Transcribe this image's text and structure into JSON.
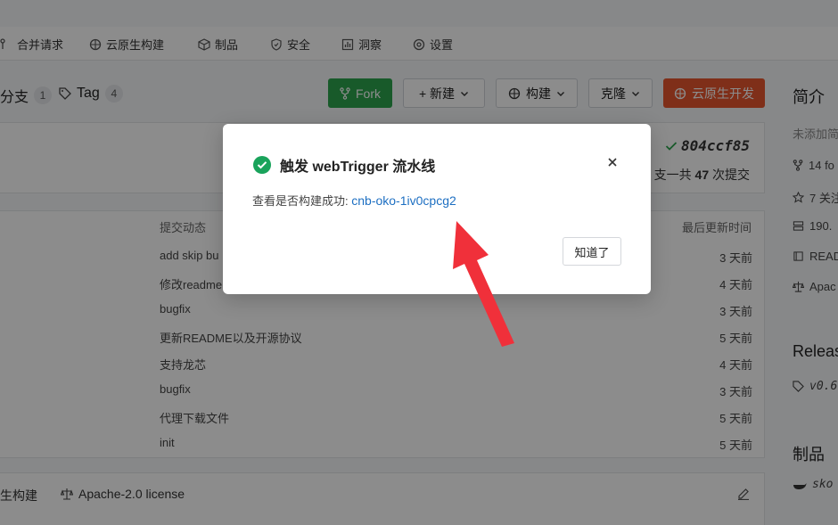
{
  "nav": {
    "items": [
      {
        "label": "合并请求",
        "icon": "merge-request-icon"
      },
      {
        "label": "云原生构建",
        "icon": "cloud-build-icon"
      },
      {
        "label": "制品",
        "icon": "package-icon"
      },
      {
        "label": "安全",
        "icon": "shield-icon"
      },
      {
        "label": "洞察",
        "icon": "chart-icon"
      },
      {
        "label": "设置",
        "icon": "gear-icon"
      }
    ]
  },
  "repo_header": {
    "branch_label": "分支",
    "branch_count": "1",
    "tag_label": "Tag",
    "tag_count": "4",
    "fork_label": "Fork",
    "new_label": "+ 新建",
    "build_label": "构建",
    "clone_label": "克隆",
    "cloud_dev_label": "云原生开发"
  },
  "commit": {
    "sha": "804ccf85",
    "summary_prefix": "支一共",
    "summary_count": "47",
    "summary_suffix": "次提交"
  },
  "file_table": {
    "col_commit": "提交动态",
    "col_time": "最后更新时间",
    "rows": [
      {
        "msg": "add skip bu",
        "time": "3 天前"
      },
      {
        "msg": "修改readme",
        "time": "4 天前"
      },
      {
        "msg": "bugfix",
        "time": "3 天前"
      },
      {
        "msg": "更新README以及开源协议",
        "time": "5 天前"
      },
      {
        "msg": "支持龙芯",
        "time": "4 天前"
      },
      {
        "msg": "bugfix",
        "time": "3 天前"
      },
      {
        "msg": "代理下载文件",
        "time": "5 天前"
      },
      {
        "msg": "init",
        "time": "5 天前"
      }
    ]
  },
  "bottom_card": {
    "left_label": "生构建",
    "license_label": "Apache-2.0 license"
  },
  "sidebar": {
    "intro_heading": "简介",
    "no_desc": "未添加简",
    "forks": "14 fo",
    "stars": "7 关注",
    "size": "190.",
    "readme": "READ",
    "license": "Apac",
    "releases_heading": "Releas",
    "release_tag": "v0.6",
    "packages_heading": "制品",
    "package_name": "sko"
  },
  "modal": {
    "title": "触发 webTrigger 流水线",
    "body_prefix": "查看是否构建成功:",
    "link_text": "cnb-oko-1iv0cpcg2",
    "confirm_label": "知道了",
    "success_color": "#19a35b",
    "link_color": "#1d6fc2"
  },
  "annotation": {
    "arrow_color": "#f0303a"
  }
}
